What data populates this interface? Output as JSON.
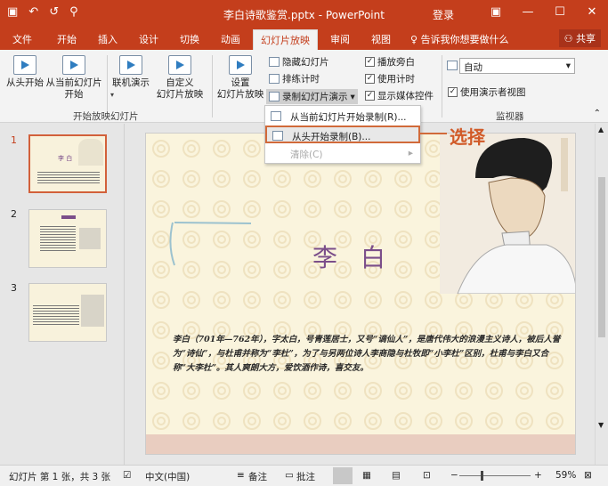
{
  "titlebar": {
    "title": "李白诗歌鉴赏.pptx - PowerPoint",
    "login": "登录",
    "save_icon": "save-icon",
    "undo_icon": "undo-icon",
    "redo_icon": "redo-icon"
  },
  "tabs": [
    "文件",
    "开始",
    "插入",
    "设计",
    "切换",
    "动画",
    "幻灯片放映",
    "审阅",
    "视图"
  ],
  "tell_me": "♀ 告诉我你想要做什么",
  "share": "共享",
  "ribbon": {
    "from_start": "从头开始",
    "from_current_1": "从当前幻灯片",
    "from_current_2": "开始",
    "online_1": "联机演示",
    "custom_1": "自定义",
    "custom_2": "幻灯片放映",
    "group_start": "开始放映幻灯片",
    "setup_1": "设置",
    "setup_2": "幻灯片放映",
    "hide_slide": "隐藏幻灯片",
    "rehearse": "排练计时",
    "record": "录制幻灯片演示",
    "play_narration": "播放旁白",
    "use_timings": "使用计时",
    "show_media": "显示媒体控件",
    "monitor_value": "自动",
    "presenter_view": "使用演示者视图",
    "group_monitor": "监视器"
  },
  "menu": {
    "item1": "从当前幻灯片开始录制(R)...",
    "item2": "从头开始录制(B)...",
    "item3": "清除(C)"
  },
  "callout": "选择",
  "slides": [
    {
      "num": "1"
    },
    {
      "num": "2"
    },
    {
      "num": "3"
    }
  ],
  "slide": {
    "title": "李白",
    "body": "李白（701年—762年），字太白，号青莲居士，又号“谪仙人”，是唐代伟大的浪漫主义诗人，被后人誉为“诗仙”，与杜甫并称为“李杜”，为了与另两位诗人李商隐与杜牧即“小李杜”区别，杜甫与李白又合称“大李杜”。其人爽朗大方，爱饮酒作诗，喜交友。"
  },
  "status": {
    "slide_info": "幻灯片 第 1 张，共 3 张",
    "lang": "中文(中国)",
    "notes": "备注",
    "comments": "批注",
    "zoom": "59%"
  }
}
